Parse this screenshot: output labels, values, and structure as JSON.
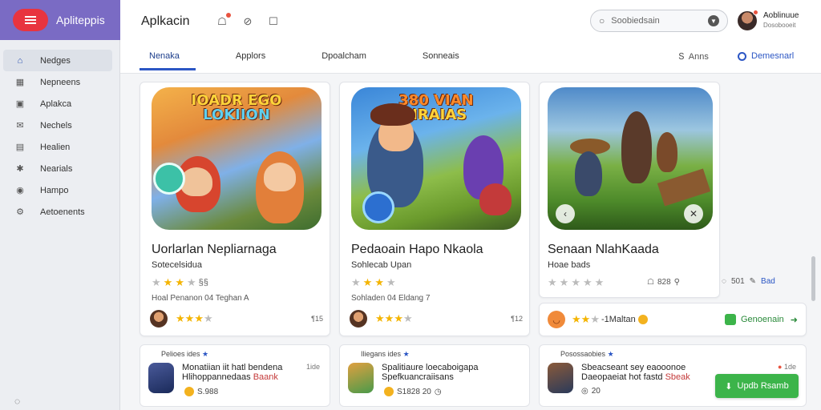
{
  "brand": {
    "name": "Apliteppis"
  },
  "sidebar": {
    "items": [
      {
        "label": "Nedges",
        "icon": "home-icon"
      },
      {
        "label": "Nepneens",
        "icon": "grid-icon"
      },
      {
        "label": "Aplakca",
        "icon": "apps-icon"
      },
      {
        "label": "Nechels",
        "icon": "bell-icon"
      },
      {
        "label": "Healien",
        "icon": "calendar-icon"
      },
      {
        "label": "Nearials",
        "icon": "tools-icon"
      },
      {
        "label": "Hampo",
        "icon": "location-icon"
      },
      {
        "label": "Aetoenents",
        "icon": "settings-icon"
      }
    ]
  },
  "header": {
    "title": "Aplkacin",
    "search_placeholder": "Soobiedsain",
    "user_name": "Aoblinuue",
    "user_sub": "Dosobooeit",
    "tabs": [
      "Nenaka",
      "Applors",
      "Dpoalcham",
      "Sonneais"
    ],
    "right_link_1": "Anns",
    "right_link_2": "Demesnarl"
  },
  "cards": [
    {
      "art_title_1": "IOADR EGO",
      "art_title_2": "LOKIION",
      "title": "Uorlarlan Nepliarnaga",
      "subtitle": "Sotecelsidua",
      "rating_text": "§§",
      "meta": "Hoal  Penanon  04  Teghan  A",
      "count": "¶15"
    },
    {
      "art_title_1": "380 VIAN",
      "art_title_2": "NRAIAS",
      "title": "Pedaoain Hapo Nkaola",
      "subtitle": "Sohlecab Upan",
      "rating_text": "",
      "meta": "Sohladen  04  Eldang  7",
      "count": "¶12"
    },
    {
      "title": "Senaan NlahKaada",
      "subtitle": "Hoae bads",
      "meta_right_1": "828",
      "meta_right_2": "501",
      "meta_right_3": "Bad"
    }
  ],
  "promo": {
    "label": "-1Maltan",
    "action": "Genoenain"
  },
  "reviews": [
    {
      "head": "Pelioes ides",
      "text_a": "Monatiian  iit  hatl  bendena",
      "text_b": "Hlihoppannedaas",
      "text_hl": "Baank",
      "right": "1ide",
      "foot": "S.988"
    },
    {
      "head": "Iliegans ides",
      "text_a": "Spalitiaure  loecaboigapa",
      "text_b": "Spefkuancraiisans",
      "text_hl": "",
      "right": "",
      "foot": "S1828  20"
    },
    {
      "head": "Posossaobies",
      "text_a": "Sbeacseant  sey  eaooonoe",
      "text_b": "Daeopaeiat hot fastd",
      "text_hl": "Sbeak",
      "right": "1de",
      "foot": "20"
    }
  ],
  "buy_button": "Updb Rsamb"
}
